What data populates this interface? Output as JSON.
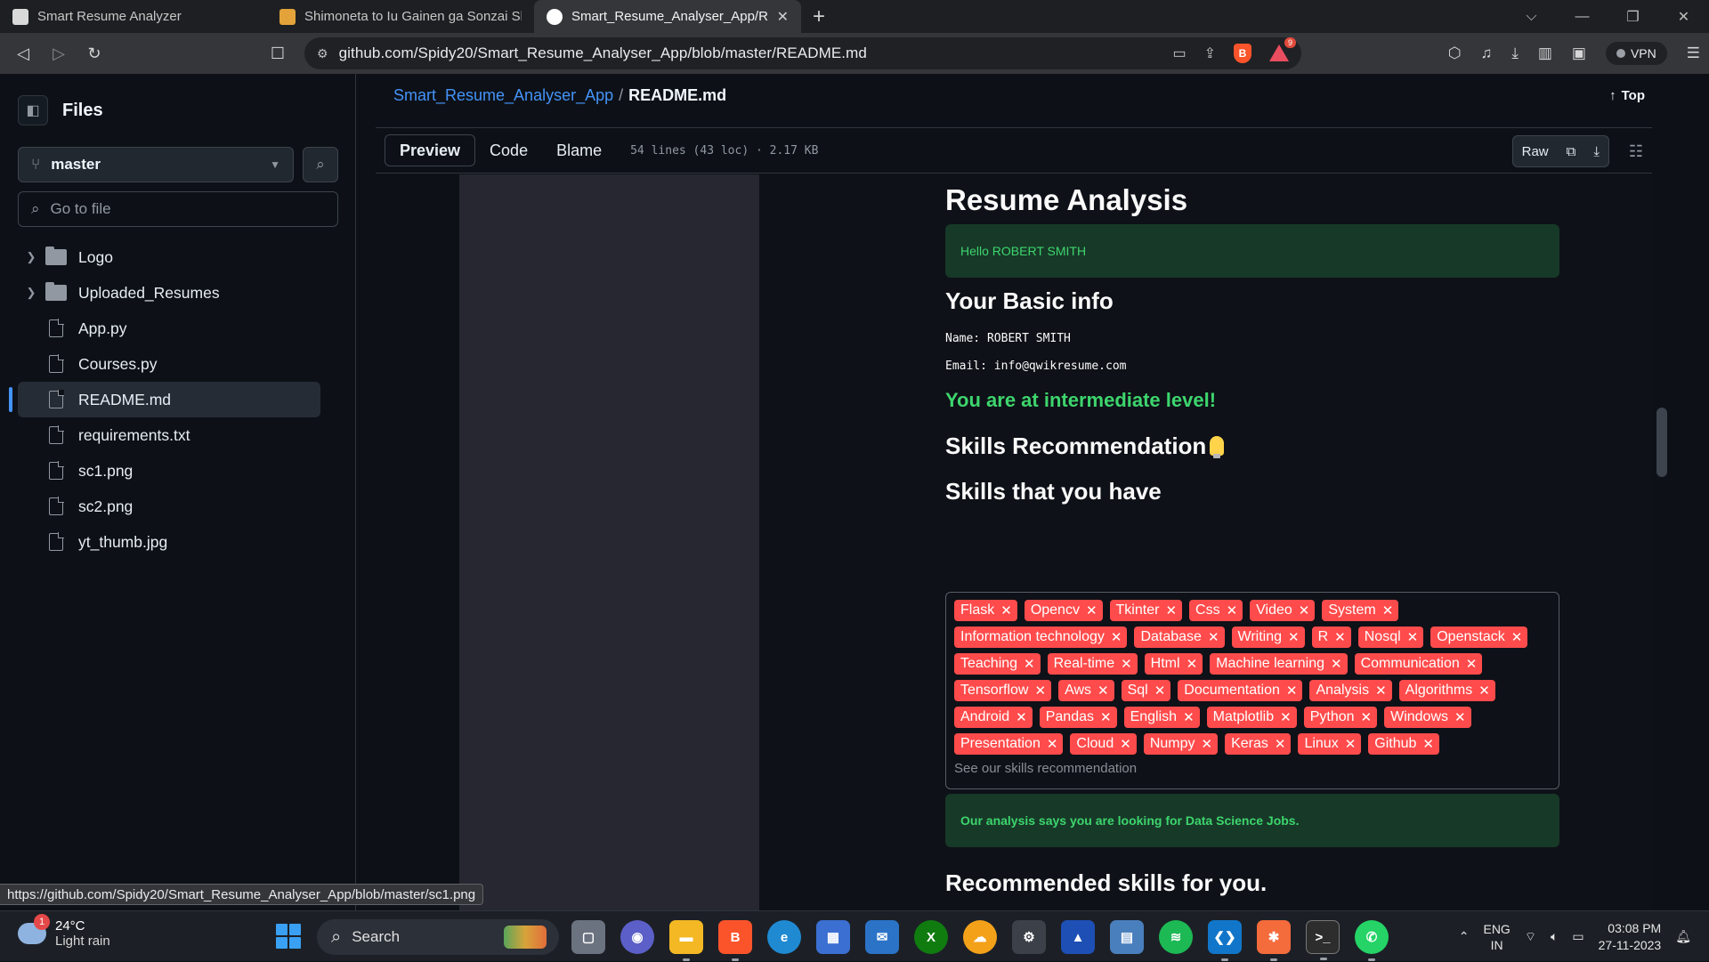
{
  "browser": {
    "tabs": [
      {
        "title": "Smart Resume Analyzer",
        "favicon_color": "#d9d9d9",
        "active": false
      },
      {
        "title": "Shimoneta to Iu Gainen ga Sonzai Shi",
        "favicon_color": "#e3a33a",
        "active": false
      },
      {
        "title": "Smart_Resume_Analyser_App/RE",
        "favicon_color": "#ffffff",
        "active": true
      }
    ],
    "url": "github.com/Spidy20/Smart_Resume_Analyser_App/blob/master/README.md",
    "rewards_count": "9",
    "vpn_label": "VPN"
  },
  "sidebar": {
    "title": "Files",
    "branch": "master",
    "goto_placeholder": "Go to file",
    "items": [
      {
        "name": "Logo",
        "type": "folder"
      },
      {
        "name": "Uploaded_Resumes",
        "type": "folder"
      },
      {
        "name": "App.py",
        "type": "file"
      },
      {
        "name": "Courses.py",
        "type": "file"
      },
      {
        "name": "README.md",
        "type": "file",
        "selected": true
      },
      {
        "name": "requirements.txt",
        "type": "file"
      },
      {
        "name": "sc1.png",
        "type": "file"
      },
      {
        "name": "sc2.png",
        "type": "file"
      },
      {
        "name": "yt_thumb.jpg",
        "type": "file"
      }
    ]
  },
  "file": {
    "repo": "Smart_Resume_Analyser_App",
    "separator": "/",
    "name": "README.md",
    "top_label": "Top",
    "tabs": [
      "Preview",
      "Code",
      "Blame"
    ],
    "info": "54 lines (43 loc) · 2.17 KB",
    "raw_label": "Raw"
  },
  "readme_image": {
    "heading": "Resume Analysis",
    "greeting": "Hello ROBERT SMITH",
    "basic_info_heading": "Your Basic info",
    "name_line": "Name: ROBERT SMITH",
    "email_line": "Email: info@qwikresume.com",
    "level": "You are at intermediate level!",
    "skills_reco_heading": "Skills Recommendation",
    "skills_have_heading": "Skills that you have",
    "skills": [
      "Flask",
      "Opencv",
      "Tkinter",
      "Css",
      "Video",
      "System",
      "Information technology",
      "Database",
      "Writing",
      "R",
      "Nosql",
      "Openstack",
      "Teaching",
      "Real-time",
      "Html",
      "Machine learning",
      "Communication",
      "Tensorflow",
      "Aws",
      "Sql",
      "Documentation",
      "Analysis",
      "Algorithms",
      "Android",
      "Pandas",
      "English",
      "Matplotlib",
      "Python",
      "Windows",
      "Presentation",
      "Cloud",
      "Numpy",
      "Keras",
      "Linux",
      "Github"
    ],
    "skills_placeholder": "See our skills recommendation",
    "analysis_note": "Our analysis says you are looking for Data Science Jobs.",
    "recommended_heading": "Recommended skills for you."
  },
  "statusbar_url": "https://github.com/Spidy20/Smart_Resume_Analyser_App/blob/master/sc1.png",
  "taskbar": {
    "weather_temp": "24°C",
    "weather_desc": "Light rain",
    "weather_badge": "1",
    "search_label": "Search",
    "lang_line1": "ENG",
    "lang_line2": "IN",
    "time": "03:08 PM",
    "date": "27-11-2023"
  },
  "colors": {
    "accent": "#4493f8",
    "tag": "#ff4b4b",
    "success": "#3dd56d"
  }
}
